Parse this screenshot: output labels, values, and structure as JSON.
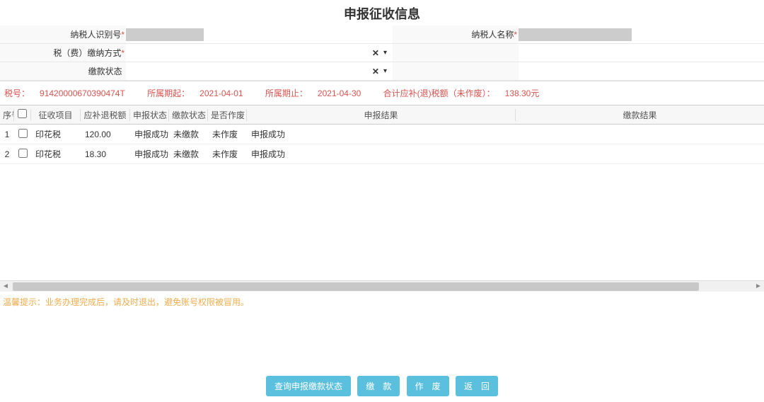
{
  "title": "申报征收信息",
  "form": {
    "taxpayer_id_label": "纳税人识别号",
    "taxpayer_name_label": "纳税人名称",
    "payment_method_label": "税（费）缴纳方式",
    "payment_status_label": "缴款状态",
    "required_mark": "*"
  },
  "summary": {
    "tax_no_label": "税号：",
    "tax_no": "91420000670390474T",
    "period_start_label": "所属期起：",
    "period_start": "2021-04-01",
    "period_end_label": "所属期止：",
    "period_end": "2021-04-30",
    "total_label": "合计应补(退)税额（未作废）：",
    "total": "138.30元"
  },
  "columns": {
    "idx": "序号",
    "item": "征收项目",
    "amount": "应补退税额",
    "sb_status": "申报状态",
    "jk_status": "缴款状态",
    "zf": "是否作废",
    "sb_result": "申报结果",
    "jk_result": "缴款结果"
  },
  "rows": [
    {
      "idx": "1",
      "item": "印花税",
      "amount": "120.00",
      "sb": "申报成功",
      "jk": "未缴款",
      "zf": "未作废",
      "res": "申报成功",
      "jkres": ""
    },
    {
      "idx": "2",
      "item": "印花税",
      "amount": "18.30",
      "sb": "申报成功",
      "jk": "未缴款",
      "zf": "未作废",
      "res": "申报成功",
      "jkres": ""
    }
  ],
  "warn": "温馨提示：业务办理完成后，请及时退出，避免账号权限被冒用。",
  "buttons": {
    "query": "查询申报缴款状态",
    "pay": "缴　款",
    "void": "作　废",
    "back": "返　回"
  }
}
